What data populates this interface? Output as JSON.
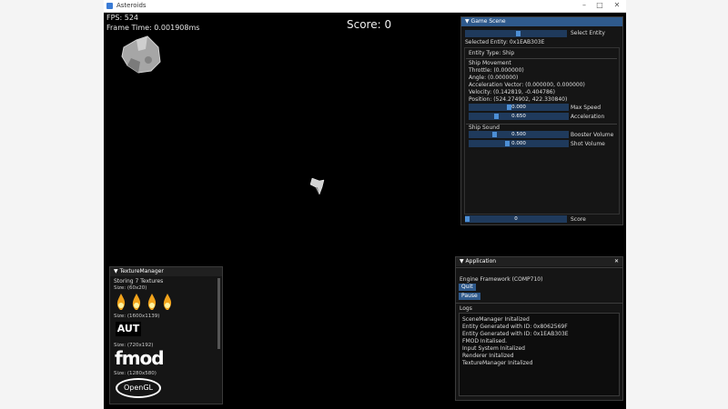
{
  "window": {
    "title": "Asteroids"
  },
  "hud": {
    "fps": "FPS: 524",
    "frame_time": "Frame Time: 0.001908ms",
    "score": "Score: 0"
  },
  "game_scene": {
    "title": "Game Scene",
    "select_entity_label": "Select Entity",
    "selected_entity": "Selected Entity: 0x1EAB303E",
    "entity_type": "Entity Type: Ship",
    "ship_movement": "Ship Movement",
    "throttle": "Throttle: (0.000000)",
    "angle": "Angle: (0.000000)",
    "acceleration_vector": "Acceleration Vector: (0.000000, 0.000000)",
    "velocity": "Velocity: (0.142819, -0.404786)",
    "position": "Position: (524.274902, 422.330840)",
    "max_speed_value": "0.000",
    "max_speed_label": "Max Speed",
    "acceleration_value": "0.650",
    "acceleration_label": "Acceleration",
    "ship_sound": "Ship Sound",
    "booster_volume_value": "0.500",
    "booster_volume_label": "Booster Volume",
    "shot_volume_value": "0.000",
    "shot_volume_label": "Shot Volume",
    "score_value": "0",
    "score_label": "Score"
  },
  "texture_manager": {
    "title": "TextureManager",
    "storing": "Storing 7 Textures",
    "sizes": [
      "Size: (60x20)",
      "Size: (1600x1139)",
      "Size: (720x192)",
      "Size: (1280x580)"
    ],
    "aut_logo": "AUT",
    "fmod_logo": "fmod",
    "opengl_logo": "OpenGL"
  },
  "application": {
    "title": "Application",
    "engine": "Engine Framework (COMP710)",
    "quit_label": "Quit",
    "pause_label": "Pause",
    "logs_label": "Logs",
    "logs": [
      "SceneManager Initalized",
      "Entity Generated with ID: 0x8062569F",
      "Entity Generated with ID: 0x1EAB303E",
      "FMOD Initalised.",
      "Input System Initalized",
      "Renderer Initalized",
      "TextureManager Initalized"
    ]
  },
  "icons": {
    "app": "app-icon",
    "collapse": "triangle-down-icon",
    "close": "close-icon"
  },
  "colors": {
    "active_header": "#2f5a8c",
    "slider": "#1f3a5c",
    "slider_grab": "#4d8fd6",
    "background": "#000000"
  }
}
